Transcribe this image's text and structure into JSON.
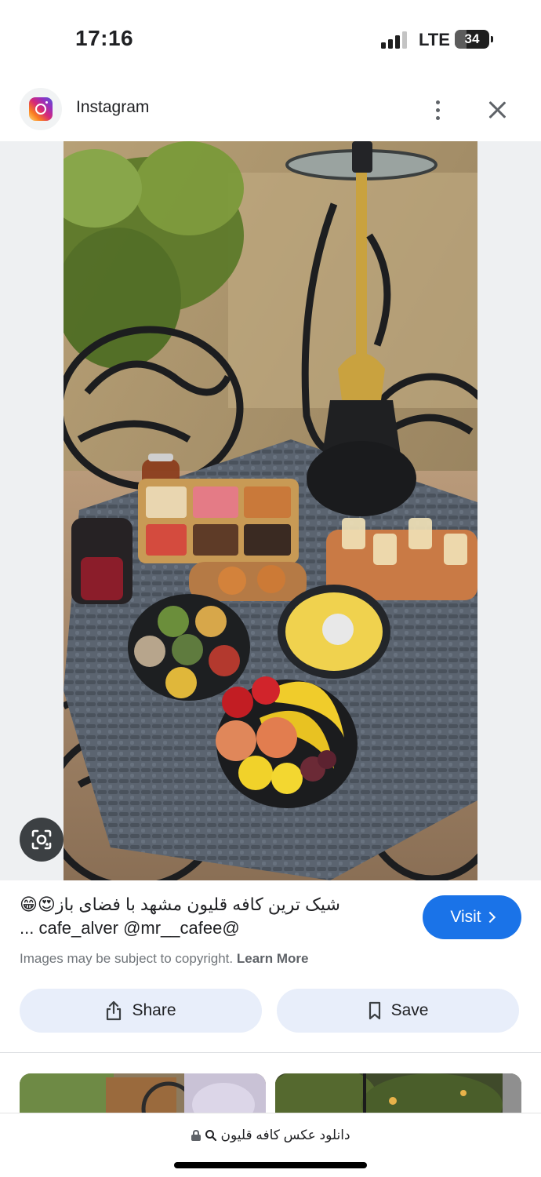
{
  "status_bar": {
    "time": "17:16",
    "network": "LTE",
    "battery": "34",
    "battery_level": 0.34
  },
  "header": {
    "app_name": "Instagram",
    "app_icon": "instagram-logo",
    "menu_icon": "more-vert-icon",
    "close_icon": "close-icon"
  },
  "image": {
    "lens_icon": "google-lens-icon"
  },
  "result": {
    "title_line1": "شیک ترین کافه قلیون مشهد با فضای باز😍😁",
    "title_line2": "@cafe_alver @mr__cafee ...",
    "visit_label": "Visit",
    "copyright_text": "Images may be subject to copyright.",
    "learn_more": "Learn More",
    "share_label": "Share",
    "save_label": "Save"
  },
  "url_bar": {
    "text": "دانلود عکس کافه قلیون",
    "lock_icon": "lock-icon",
    "search_icon": "search-icon"
  },
  "colors": {
    "accent": "#1a73e8",
    "action_bg": "#e8eefa",
    "image_bg": "#eef0f2"
  }
}
